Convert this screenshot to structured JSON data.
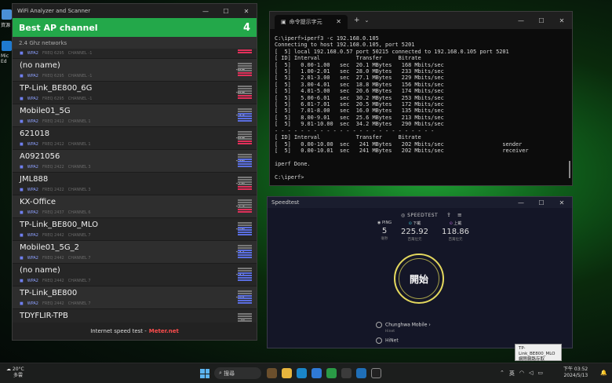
{
  "desktop": {
    "label1": "資源",
    "label2": "Mic Ed"
  },
  "wifi": {
    "title": "WiFi Analyzer and Scanner",
    "header_title": "Best AP channel",
    "header_value": "4",
    "band": "2.4 Ghz networks",
    "footer_text": "Internet speed test -",
    "footer_link": "Meter.net",
    "networks": [
      {
        "name": "",
        "security": "WPA2",
        "freq": "FREQ 6295",
        "channel": "CHANNEL -1",
        "signal": "-65",
        "level": "low"
      },
      {
        "name": "(no name)",
        "security": "WPA2",
        "freq": "FREQ 6295",
        "channel": "CHANNEL -1",
        "signal": "-69",
        "level": "low"
      },
      {
        "name": "TP-Link_BE800_6G",
        "security": "WPA2",
        "freq": "FREQ 6295",
        "channel": "CHANNEL -1",
        "signal": "-69",
        "level": "low"
      },
      {
        "name": "Mobile01_5G",
        "security": "WPA2",
        "freq": "FREQ 2412",
        "channel": "CHANNEL 1",
        "signal": "-55",
        "level": "mid"
      },
      {
        "name": "621018",
        "security": "WPA2",
        "freq": "FREQ 2412",
        "channel": "CHANNEL 1",
        "signal": "-69",
        "level": "low"
      },
      {
        "name": "A0921056",
        "security": "WPA2",
        "freq": "FREQ 2422",
        "channel": "CHANNEL 3",
        "signal": "-56",
        "level": "mid"
      },
      {
        "name": "JML888",
        "security": "WPA2",
        "freq": "FREQ 2422",
        "channel": "CHANNEL 3",
        "signal": "-76",
        "level": "low"
      },
      {
        "name": "KX-Office",
        "security": "WPA2",
        "freq": "FREQ 2437",
        "channel": "CHANNEL 6",
        "signal": "-75",
        "level": "low"
      },
      {
        "name": "TP-Link_BE800_MLO",
        "security": "WPA2",
        "freq": "FREQ 2442",
        "channel": "CHANNEL 7",
        "signal": "-46",
        "level": "mid"
      },
      {
        "name": "Mobile01_5G_2",
        "security": "WPA2",
        "freq": "FREQ 2442",
        "channel": "CHANNEL 7",
        "signal": "-57",
        "level": "mid"
      },
      {
        "name": "(no name)",
        "security": "WPA2",
        "freq": "FREQ 2442",
        "channel": "CHANNEL 7",
        "signal": "-57",
        "level": "mid"
      },
      {
        "name": "TP-Link_BE800",
        "security": "WPA2",
        "freq": "FREQ 2442",
        "channel": "CHANNEL 7",
        "signal": "-44",
        "level": "mid"
      },
      {
        "name": "TDYFLIR-TPB",
        "security": "WPA2",
        "freq": "FREQ 2442",
        "channel": "CHANNEL 7",
        "signal": "--",
        "level": "high"
      }
    ]
  },
  "cmd": {
    "tab_title": "命令提示字元",
    "output": "C:\\iperf>iperf3 -c 192.168.0.105\nConnecting to host 192.168.0.105, port 5201\n[  5] local 192.168.0.57 port 50215 connected to 192.168.0.105 port 5201\n[ ID] Interval           Transfer     Bitrate\n[  5]   0.00-1.00   sec  20.1 MBytes   168 Mbits/sec\n[  5]   1.00-2.01   sec  28.0 MBytes   233 Mbits/sec\n[  5]   2.01-3.00   sec  27.1 MBytes   229 Mbits/sec\n[  5]   3.00-4.01   sec  18.8 MBytes   156 Mbits/sec\n[  5]   4.01-5.00   sec  20.6 MBytes   174 Mbits/sec\n[  5]   5.00-6.01   sec  30.2 MBytes   253 Mbits/sec\n[  5]   6.01-7.01   sec  20.5 MBytes   172 Mbits/sec\n[  5]   7.01-8.00   sec  16.0 MBytes   135 Mbits/sec\n[  5]   8.00-9.01   sec  25.6 MBytes   213 Mbits/sec\n[  5]   9.01-10.00  sec  34.2 MBytes   290 Mbits/sec\n- - - - - - - - - - - - - - - - - - - - - - - - -\n[ ID] Interval           Transfer     Bitrate\n[  5]   0.00-10.00  sec   241 MBytes   202 Mbits/sec                  sender\n[  5]   0.00-10.01  sec   241 MBytes   202 Mbits/sec                  receiver\n\niperf Done.\n\nC:\\iperf>"
  },
  "speedtest": {
    "title": "Speedtest",
    "logo": "SPEEDTEST",
    "ping_label": "PING",
    "ping_unit": "毫秒",
    "ping_value": "5",
    "download_label": "下載",
    "download_value": "225.92",
    "download_unit": "百萬位元",
    "upload_label": "上載",
    "upload_value": "118.86",
    "upload_unit": "百萬位元",
    "go_label": "開始",
    "isp_name": "Chunghwa Mobile",
    "isp_sub": "Hinet",
    "host_name": "HiNet"
  },
  "tooltip": {
    "line1": "TP-Link_BE800_MLO",
    "line2": "網際網路存取"
  },
  "taskbar": {
    "weather_temp": "20°C",
    "weather_desc": "多雲",
    "search_placeholder": "搜尋",
    "ime": "英",
    "time": "下午 03:52",
    "date": "2024/5/13"
  },
  "colors": {
    "accent_green": "#23a84a",
    "signal_red": "#e0305a",
    "signal_blue": "#5a6ee0",
    "signal_green": "#3cc65a",
    "speed_ring": "#e4d85e"
  }
}
